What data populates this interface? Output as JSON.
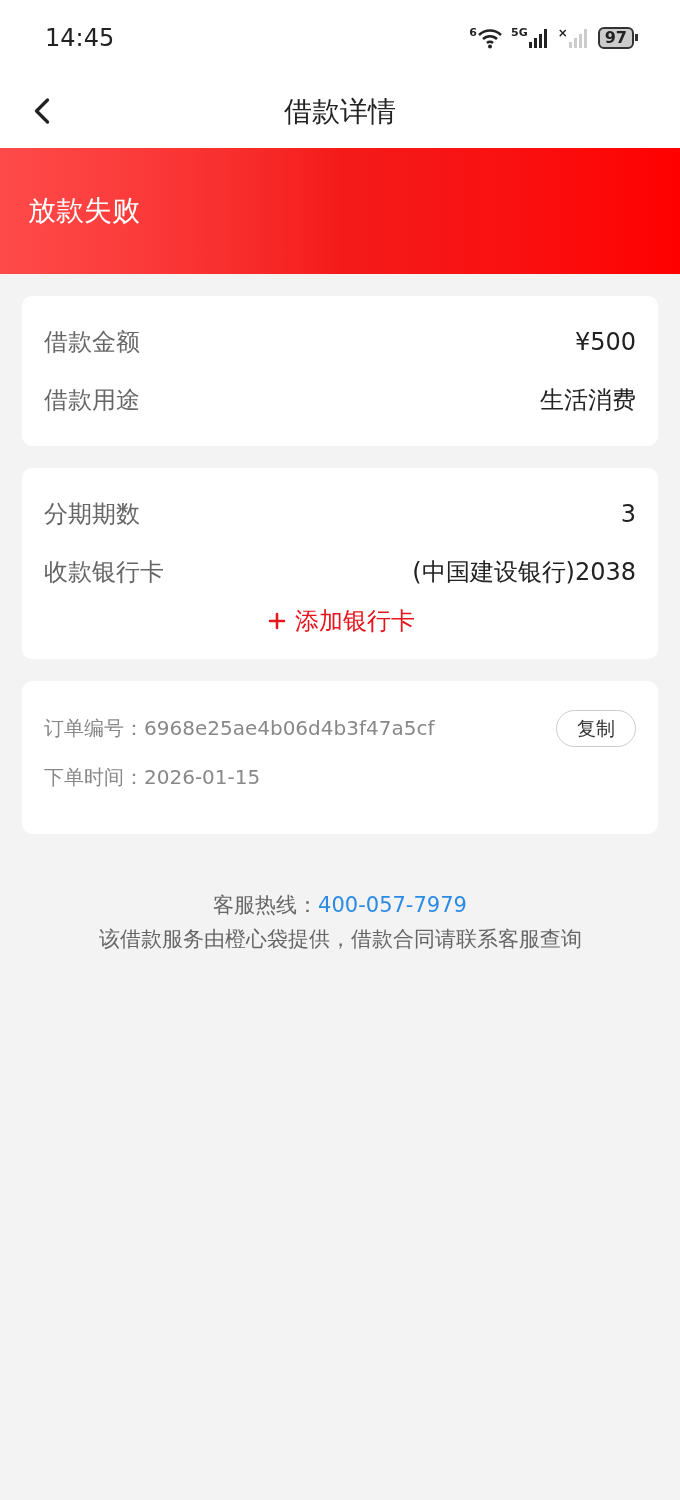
{
  "status_bar": {
    "time": "14:45",
    "wifi_badge": "6",
    "network": "5G",
    "sim2_mark": "×",
    "battery": "97"
  },
  "nav": {
    "title": "借款详情"
  },
  "banner": {
    "status": "放款失败"
  },
  "loan_card": {
    "rows": [
      {
        "label": "借款金额",
        "value": "¥500"
      },
      {
        "label": "借款用途",
        "value": "生活消费"
      }
    ]
  },
  "repay_card": {
    "rows": [
      {
        "label": "分期期数",
        "value": "3"
      },
      {
        "label": "收款银行卡",
        "value": "(中国建设银行)2038"
      }
    ],
    "add_card_button": "添加银行卡"
  },
  "order_card": {
    "order_no": "订单编号：6968e25ae4b06d4b3f47a5cf",
    "copy_button": "复制",
    "order_time": "下单时间：2026-01-15"
  },
  "footer": {
    "hotline_label": "客服热线：",
    "hotline_number": "400-057-7979",
    "note": "该借款服务由橙心袋提供，借款合同请联系客服查询"
  }
}
